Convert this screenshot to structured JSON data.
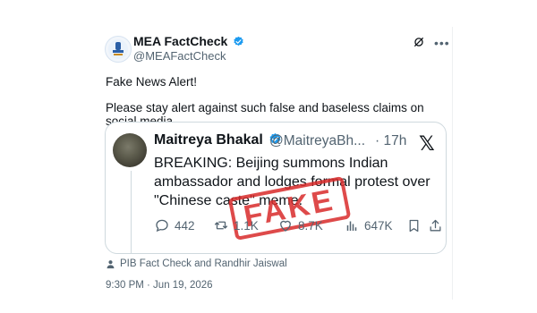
{
  "author": {
    "name": "MEA FactCheck",
    "handle": "@MEAFactCheck"
  },
  "post": {
    "line1": "Fake News Alert!",
    "line2": "Please stay alert against such false and baseless claims on social media."
  },
  "quoted": {
    "name": "Maitreya Bhakal",
    "handle": "@MaitreyaBh...",
    "time": "· 17h",
    "text": "BREAKING: Beijing summons Indian ambassador and lodges formal protest over \"Chinese caste\" meme.",
    "replies": "442",
    "reposts": "1.1K",
    "likes": "8.7K",
    "views": "647K",
    "stamp": "FAKE"
  },
  "context": "PIB Fact Check and Randhir Jaiswal",
  "timestamp": "9:30 PM · Jun 19, 2026",
  "colors": {
    "verified": "#1d9bf0",
    "stamp": "#d92b2b",
    "muted": "#536471"
  },
  "icons": [
    "verified-badge-icon",
    "grok-icon",
    "more-icon",
    "x-logo-icon",
    "reply-icon",
    "repost-icon",
    "like-icon",
    "views-icon",
    "bookmark-icon",
    "share-icon",
    "person-icon"
  ]
}
